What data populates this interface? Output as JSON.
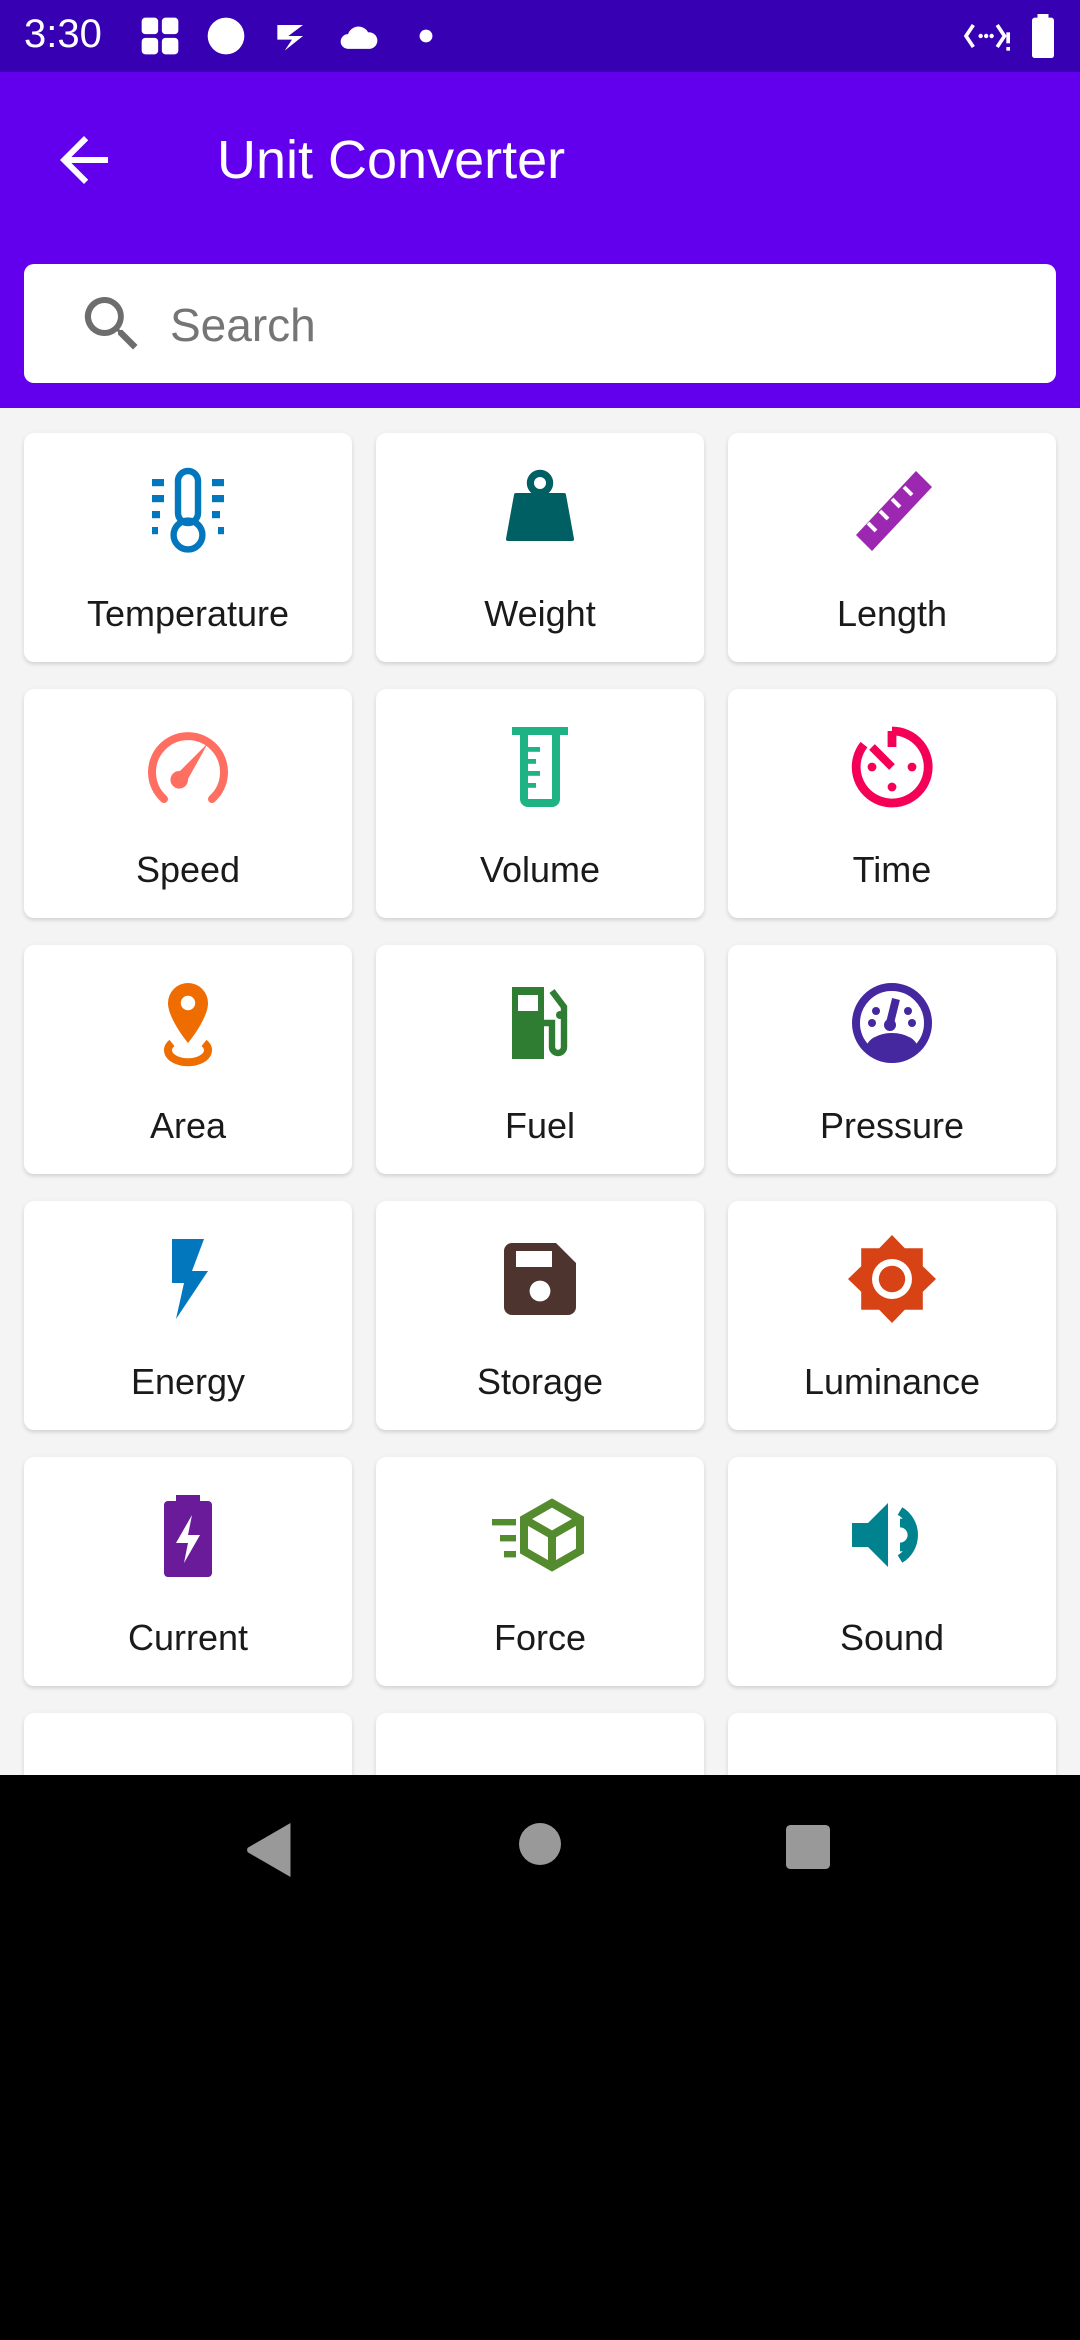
{
  "status_bar": {
    "time": "3:30"
  },
  "app_bar": {
    "title": "Unit Converter",
    "back_icon": "arrow-back-icon"
  },
  "search": {
    "placeholder": "Search",
    "value": "",
    "icon": "search-icon"
  },
  "colors": {
    "status_bar": "#3700B3",
    "primary": "#6200EE",
    "background": "#F4F4F4"
  },
  "categories": [
    {
      "label": "Temperature",
      "icon": "thermometer",
      "color": "#0277BD"
    },
    {
      "label": "Weight",
      "icon": "weight",
      "color": "#005F63"
    },
    {
      "label": "Length",
      "icon": "ruler",
      "color": "#9C27B0"
    },
    {
      "label": "Speed",
      "icon": "speedometer",
      "color": "#FF6F61"
    },
    {
      "label": "Volume",
      "icon": "beaker",
      "color": "#1DB385"
    },
    {
      "label": "Time",
      "icon": "timer",
      "color": "#F50057"
    },
    {
      "label": "Area",
      "icon": "map-pin",
      "color": "#EF6C00"
    },
    {
      "label": "Fuel",
      "icon": "fuel-pump",
      "color": "#2E7D32"
    },
    {
      "label": "Pressure",
      "icon": "gauge",
      "color": "#4527A0"
    },
    {
      "label": "Energy",
      "icon": "lightning",
      "color": "#0277BD"
    },
    {
      "label": "Storage",
      "icon": "floppy",
      "color": "#4E342E"
    },
    {
      "label": "Luminance",
      "icon": "brightness",
      "color": "#D84315"
    },
    {
      "label": "Current",
      "icon": "battery-charging",
      "color": "#6A1B9A"
    },
    {
      "label": "Force",
      "icon": "cube-moving",
      "color": "#558B2F"
    },
    {
      "label": "Sound",
      "icon": "speaker",
      "color": "#00838F"
    },
    {
      "label": "",
      "icon": "blank",
      "color": "#FFFFFF"
    },
    {
      "label": "",
      "icon": "block",
      "color": "#1565C0"
    },
    {
      "label": "",
      "icon": "slash",
      "color": "#EF6C00"
    }
  ]
}
